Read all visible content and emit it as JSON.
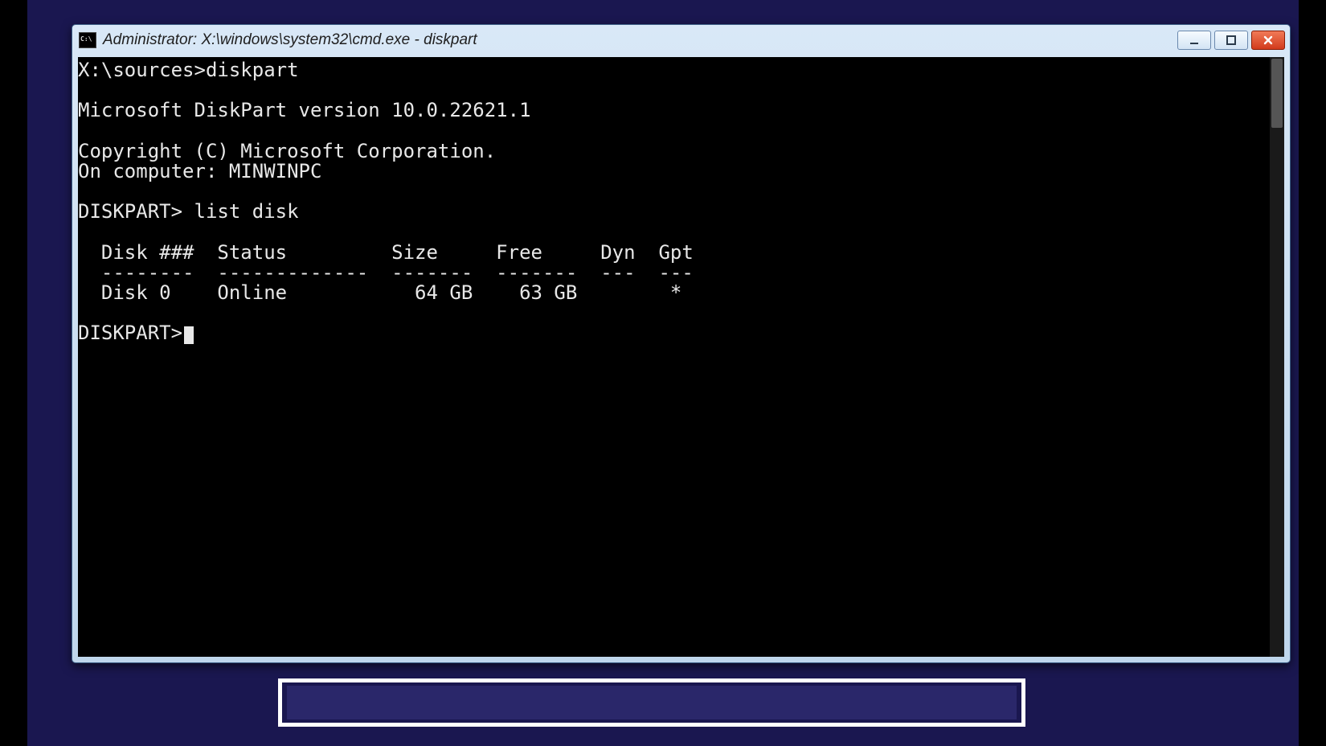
{
  "window": {
    "title": "Administrator: X:\\windows\\system32\\cmd.exe - diskpart"
  },
  "terminal": {
    "line_prompt1": "X:\\sources>diskpart",
    "line_blank1": "",
    "line_version": "Microsoft DiskPart version 10.0.22621.1",
    "line_blank2": "",
    "line_copyright": "Copyright (C) Microsoft Corporation.",
    "line_computer": "On computer: MINWINPC",
    "line_blank3": "",
    "line_cmd1": "DISKPART> list disk",
    "line_blank4": "",
    "table_header": "  Disk ###  Status         Size     Free     Dyn  Gpt",
    "table_rule": "  --------  -------------  -------  -------  ---  ---",
    "table_row0": "  Disk 0    Online           64 GB    63 GB        *",
    "line_blank5": "",
    "line_prompt2": "DISKPART>"
  },
  "disk_table": {
    "columns": [
      "Disk ###",
      "Status",
      "Size",
      "Free",
      "Dyn",
      "Gpt"
    ],
    "rows": [
      {
        "disk": "Disk 0",
        "status": "Online",
        "size": "64 GB",
        "free": "63 GB",
        "dyn": "",
        "gpt": "*"
      }
    ]
  }
}
